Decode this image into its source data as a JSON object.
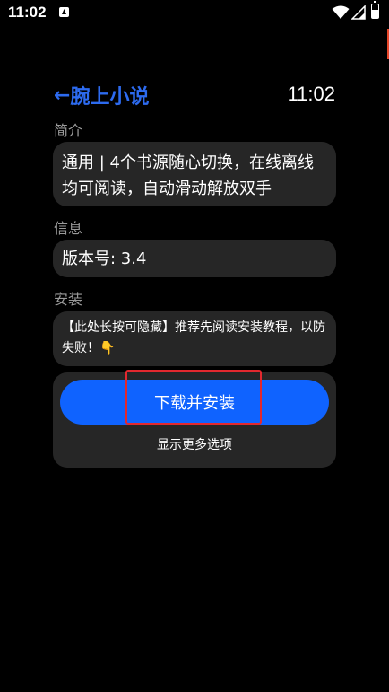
{
  "status_bar": {
    "time": "11:02",
    "icons": [
      "app-notification-icon",
      "wifi-icon",
      "signal-icon",
      "battery-icon"
    ]
  },
  "header": {
    "back_arrow": "←",
    "title": "腕上小说",
    "clock": "11:02"
  },
  "sections": {
    "intro": {
      "label": "简介",
      "text": "通用 | 4个书源随心切换，在线离线均可阅读，自动滑动解放双手"
    },
    "info": {
      "label": "信息",
      "text": "版本号: 3.4"
    },
    "install": {
      "label": "安装",
      "note": "【此处长按可隐藏】推荐先阅读安装教程，以防失败！👇"
    }
  },
  "actions": {
    "download_label": "下载并安装",
    "more_options_label": "显示更多选项"
  },
  "colors": {
    "accent": "#0f63ff",
    "title_blue": "#2d6bf0",
    "card_bg": "#262626",
    "highlight": "#e3282e"
  }
}
